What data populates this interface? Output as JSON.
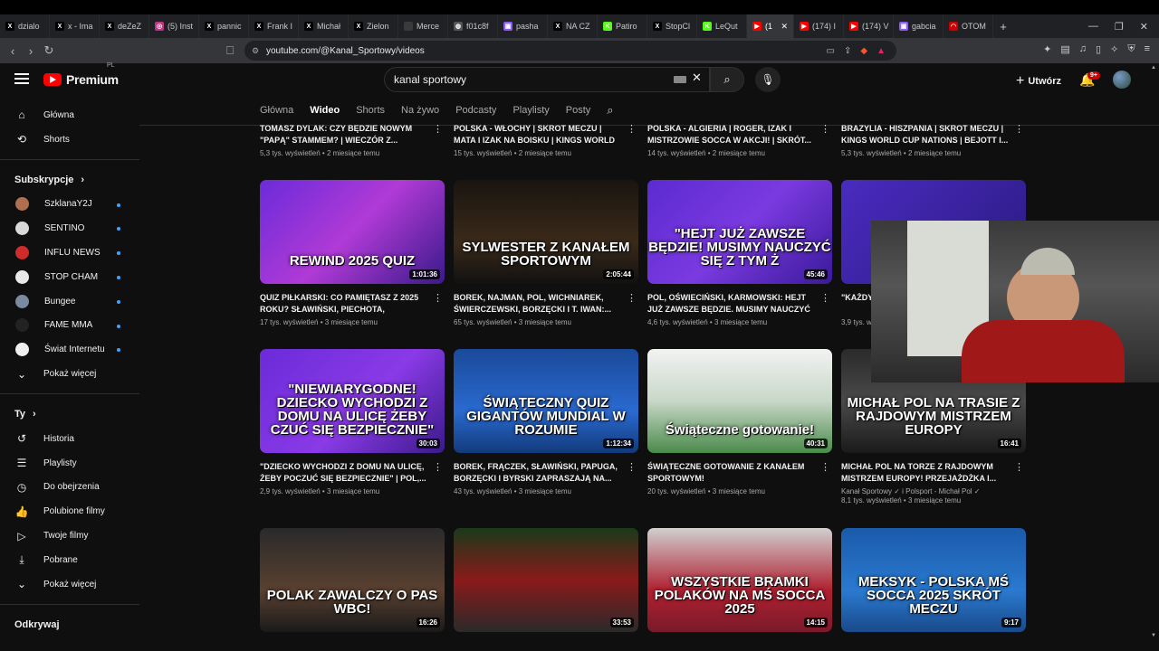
{
  "browser": {
    "tabs": [
      {
        "label": "dzialo",
        "fav": "X",
        "color": "#000000"
      },
      {
        "label": "x - Ima",
        "fav": "X",
        "color": "#000000"
      },
      {
        "label": "deZeZ",
        "fav": "X",
        "color": "#000000"
      },
      {
        "label": "(5) Inst",
        "fav": "◎",
        "color": "#c13584"
      },
      {
        "label": "pannic",
        "fav": "X",
        "color": "#000000"
      },
      {
        "label": "Frank I",
        "fav": "X",
        "color": "#000000"
      },
      {
        "label": "Michał",
        "fav": "X",
        "color": "#000000"
      },
      {
        "label": "Zielon",
        "fav": "X",
        "color": "#000000"
      },
      {
        "label": "Merce",
        "fav": "",
        "color": "#3a3a3a"
      },
      {
        "label": "f01c8f",
        "fav": "◍",
        "color": "#555555"
      },
      {
        "label": "pasha",
        "fav": "▣",
        "color": "#8b5cf6"
      },
      {
        "label": "NA CZ",
        "fav": "X",
        "color": "#000000"
      },
      {
        "label": "Patiro",
        "fav": "K",
        "color": "#53fc18"
      },
      {
        "label": "StopCl",
        "fav": "X",
        "color": "#000000"
      },
      {
        "label": "LeQut",
        "fav": "K",
        "color": "#53fc18"
      },
      {
        "label": "(1",
        "fav": "▶",
        "color": "#ff0000",
        "active": true
      },
      {
        "label": "(174) I",
        "fav": "▶",
        "color": "#ff0000"
      },
      {
        "label": "(174) V",
        "fav": "▶",
        "color": "#ff0000"
      },
      {
        "label": "gabcia",
        "fav": "▣",
        "color": "#8b5cf6"
      },
      {
        "label": "OTOM",
        "fav": "◠",
        "color": "#cc0000"
      }
    ],
    "new_tab": "+",
    "url": "youtube.com/@Kanal_Sportowy/videos"
  },
  "header": {
    "logo": "Premium",
    "logo_region": "PL",
    "search_value": "kanal sportowy",
    "create_label": "Utwórz",
    "notif_count": "9+"
  },
  "sidebar": {
    "main": [
      {
        "label": "Główna",
        "icon": "home-icon",
        "glyph": "⌂"
      },
      {
        "label": "Shorts",
        "icon": "shorts-icon",
        "glyph": "⟲"
      }
    ],
    "subs_title": "Subskrypcje",
    "subs": [
      {
        "label": "SzklanaY2J",
        "color": "#b07050",
        "dot": true
      },
      {
        "label": "SENTINO",
        "color": "#d9d9d9",
        "dot": true
      },
      {
        "label": "INFLU NEWS",
        "color": "#d02b2b",
        "dot": true
      },
      {
        "label": "STOP CHAM",
        "color": "#e8e8e8",
        "dot": true
      },
      {
        "label": "Bungee",
        "color": "#7a8aa0",
        "dot": true
      },
      {
        "label": "FAME MMA",
        "color": "#222222",
        "dot": true
      },
      {
        "label": "Świat Internetu",
        "color": "#f0f0f0",
        "dot": true
      }
    ],
    "subs_more": "Pokaż więcej",
    "you_title": "Ty",
    "you": [
      {
        "label": "Historia",
        "icon": "history-icon",
        "glyph": "↺"
      },
      {
        "label": "Playlisty",
        "icon": "playlist-icon",
        "glyph": "☰"
      },
      {
        "label": "Do obejrzenia",
        "icon": "watch-later-icon",
        "glyph": "◷"
      },
      {
        "label": "Polubione filmy",
        "icon": "like-icon",
        "glyph": "👍"
      },
      {
        "label": "Twoje filmy",
        "icon": "your-videos-icon",
        "glyph": "▷"
      },
      {
        "label": "Pobrane",
        "icon": "download-icon",
        "glyph": "⤓"
      },
      {
        "label": "Pokaż więcej",
        "icon": "chevron-down-icon",
        "glyph": "⌄"
      }
    ],
    "explore_title": "Odkrywaj"
  },
  "channel_tabs": [
    {
      "label": "Główna"
    },
    {
      "label": "Wideo",
      "active": true
    },
    {
      "label": "Shorts"
    },
    {
      "label": "Na żywo"
    },
    {
      "label": "Podcasty"
    },
    {
      "label": "Playlisty"
    },
    {
      "label": "Posty"
    }
  ],
  "videos_row0": [
    {
      "title": "TOMASZ DYLAK: CZY BĘDZIE NOWYM \"PAPĄ\" STAMMEM? | WIECZÓR Z...",
      "meta": "5,3 tys. wyświetleń • 2 miesiące temu"
    },
    {
      "title": "POLSKA - WŁOCHY | SKRÓT MECZU | MATA I IZAK NA BOISKU | KINGS WORLD CUP...",
      "meta": "15 tys. wyświetleń • 2 miesiące temu"
    },
    {
      "title": "POLSKA - ALGIERIA | ROGER, IZAK I MISTRZOWIE SOCCA W AKCJI! | SKRÓT...",
      "meta": "14 tys. wyświetleń • 2 miesiące temu"
    },
    {
      "title": "BRAZYLIA - HISZPANIA | SKRÓT MECZU | KINGS WORLD CUP NATIONS | BEJOTT I...",
      "meta": "5,3 tys. wyświetleń • 2 miesiące temu"
    }
  ],
  "videos_row1": [
    {
      "title": "QUIZ PIŁKARSKI: CO PAMIĘTASZ Z 2025 ROKU? SŁAWIŃSKI, PIECHOTA, BORZĘCKI,...",
      "meta": "17 tys. wyświetleń • 3 miesiące temu",
      "duration": "1:01:36",
      "thumb_text": "REWIND 2025 QUIZ",
      "bg": "linear-gradient(135deg,#6b2bd9,#b03ad6 50%,#3a1a8a)"
    },
    {
      "title": "BOREK, NAJMAN, POL, WICHNIAREK, ŚWIERCZEWSKI, BORZĘCKI I T. IWAN:...",
      "meta": "65 tys. wyświetleń • 3 miesiące temu",
      "duration": "2:05:44",
      "thumb_text": "SYLWESTER Z KANAŁEM SPORTOWYM",
      "bg": "linear-gradient(180deg,#1a1410,#3a2a1a 60%,#111)"
    },
    {
      "title": "POL, OŚWIECIŃSKI, KARMOWSKI: HEJT JUŻ ZAWSZE BĘDZIE. MUSIMY NAUCZYĆ SIĘ Z...",
      "meta": "4,6 tys. wyświetleń • 3 miesiące temu",
      "duration": "45:46",
      "thumb_text": "\"HEJT JUŻ ZAWSZE BĘDZIE! MUSIMY NAUCZYĆ SIĘ Z TYM Ż",
      "bg": "linear-gradient(135deg,#5b2bd0,#7a3ae0 50%,#3a1a9a)"
    },
    {
      "title": "\"KAŻDY ... ODWAŻ...",
      "meta": "3,9 tys. wyświetleń",
      "duration": "",
      "thumb_text": "",
      "bg": "linear-gradient(135deg,#4a2bc0,#2a1a80)"
    }
  ],
  "videos_row2": [
    {
      "title": "\"DZIECKO WYCHODZI Z DOMU NA ULICĘ, ŻEBY POCZUĆ SIĘ BEZPIECZNIE\" | POL,...",
      "meta": "2,9 tys. wyświetleń • 3 miesiące temu",
      "duration": "30:03",
      "thumb_text": "\"NIEWIARYGODNE! DZIECKO WYCHODZI Z DOMU NA ULICĘ ŻEBY CZUĆ SIĘ BEZPIECZNIE\"",
      "bg": "linear-gradient(135deg,#6b2bd9,#8a3ae6 55%,#3a1a8a)"
    },
    {
      "title": "BOREK, FRĄCZEK, SŁAWIŃSKI, PAPUGA, BORZĘCKI I BYRSKI ZAPRASZAJĄ NA...",
      "meta": "43 tys. wyświetleń • 3 miesiące temu",
      "duration": "1:12:34",
      "thumb_text": "ŚWIĄTECZNY QUIZ GIGANTÓW MUNDIAL W ROZUMIE",
      "bg": "linear-gradient(180deg,#1a4a9a,#2a6ad0 60%,#123a7a)"
    },
    {
      "title": "ŚWIĄTECZNE GOTOWANIE Z KANAŁEM SPORTOWYM!",
      "meta": "20 tys. wyświetleń • 3 miesiące temu",
      "duration": "40:31",
      "thumb_text": "Świąteczne gotowanie!",
      "bg": "linear-gradient(180deg,#f2f2f2,#c8d8c8 50%,#4a8a4a)"
    },
    {
      "title": "MICHAŁ POL NA TORZE Z RAJDOWYM MISTRZEM EUROPY! PRZEJAŻDŻKA I...",
      "meta": "8,1 tys. wyświetleń • 3 miesiące temu",
      "duration": "16:41",
      "thumb_text": "MICHAŁ POL NA TRASIE Z RAJDOWYM MISTRZEM EUROPY",
      "bg": "linear-gradient(180deg,#2a2a2a,#4a4a4a 50%,#1a1a1a)",
      "channel": "Kanał Sportowy ✓ i Polsport - Michał Pol ✓"
    }
  ],
  "videos_row3": [
    {
      "duration": "16:26",
      "thumb_text": "POLAK ZAWALCZY O PAS WBC!",
      "bg": "linear-gradient(180deg,#2a2a2a,#5a4030 60%,#1a1a1a)"
    },
    {
      "duration": "33:53",
      "thumb_text": "",
      "bg": "linear-gradient(180deg,#1a3a1a,#8a1a1a 50%,#2a2a2a)"
    },
    {
      "duration": "14:15",
      "thumb_text": "WSZYSTKIE BRAMKI POLAKÓW NA MŚ SOCCA 2025",
      "bg": "linear-gradient(180deg,#d0d0d0,#b02030 60%,#7a1a2a)"
    },
    {
      "duration": "9:17",
      "thumb_text": "MEKSYK - POLSKA MŚ SOCCA 2025 SKRÓT MECZU",
      "bg": "linear-gradient(180deg,#1a5aaa,#2a7ad0 60%,#1a4a8a)"
    }
  ]
}
